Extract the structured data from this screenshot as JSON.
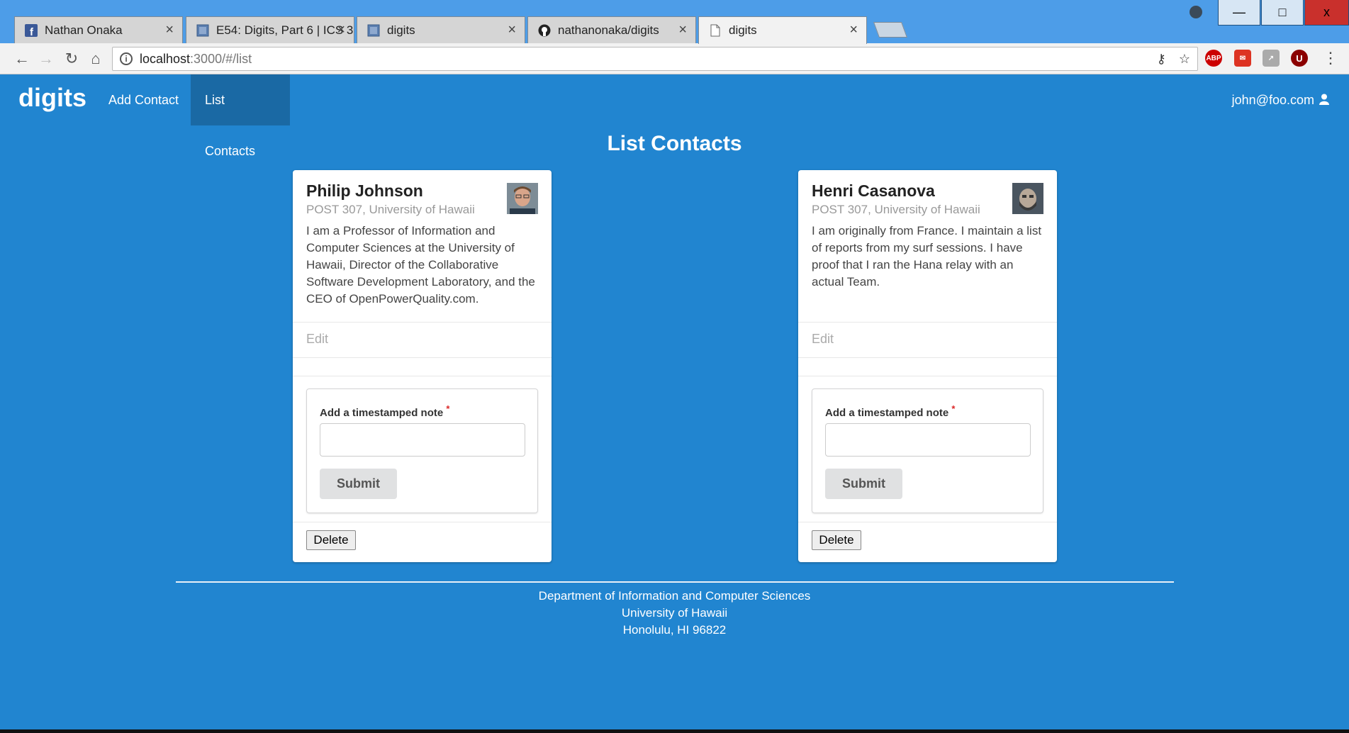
{
  "browser": {
    "tabs": [
      {
        "title": "Nathan Onaka",
        "icon": "facebook-icon"
      },
      {
        "title": "E54: Digits, Part 6 | ICS 3",
        "icon": "page-icon"
      },
      {
        "title": "digits",
        "icon": "page-icon"
      },
      {
        "title": "nathanonaka/digits",
        "icon": "github-icon"
      },
      {
        "title": "digits",
        "icon": "document-icon"
      }
    ],
    "url_host": "localhost",
    "url_path": ":3000/#/list",
    "window_min": "—",
    "window_max": "□",
    "window_close": "x",
    "ext_abp": "ABP",
    "ext_u": "U"
  },
  "nav": {
    "brand": "digits",
    "add_contact": "Add Contact",
    "list_contacts": "List Contacts",
    "user": "john@foo.com"
  },
  "page": {
    "title": "List Contacts"
  },
  "contacts": [
    {
      "name": "Philip Johnson",
      "address": "POST 307, University of Hawaii",
      "description": "I am a Professor of Information and Computer Sciences at the University of Hawaii, Director of the Collaborative Software Development Laboratory, and the CEO of OpenPowerQuality.com.",
      "edit": "Edit",
      "note_label": "Add a timestamped note",
      "required_mark": "*",
      "submit": "Submit",
      "delete": "Delete"
    },
    {
      "name": "Henri Casanova",
      "address": "POST 307, University of Hawaii",
      "description": "I am originally from France. I maintain a list of reports from my surf sessions. I have proof that I ran the Hana relay with an actual Team.",
      "edit": "Edit",
      "note_label": "Add a timestamped note",
      "required_mark": "*",
      "submit": "Submit",
      "delete": "Delete"
    }
  ],
  "footer": {
    "line1": "Department of Information and Computer Sciences",
    "line2": "University of Hawaii",
    "line3": "Honolulu, HI 96822"
  },
  "colors": {
    "app_background": "#2185d0",
    "nav_active": "#1a69a4",
    "chrome_frame": "#4d9de8"
  }
}
